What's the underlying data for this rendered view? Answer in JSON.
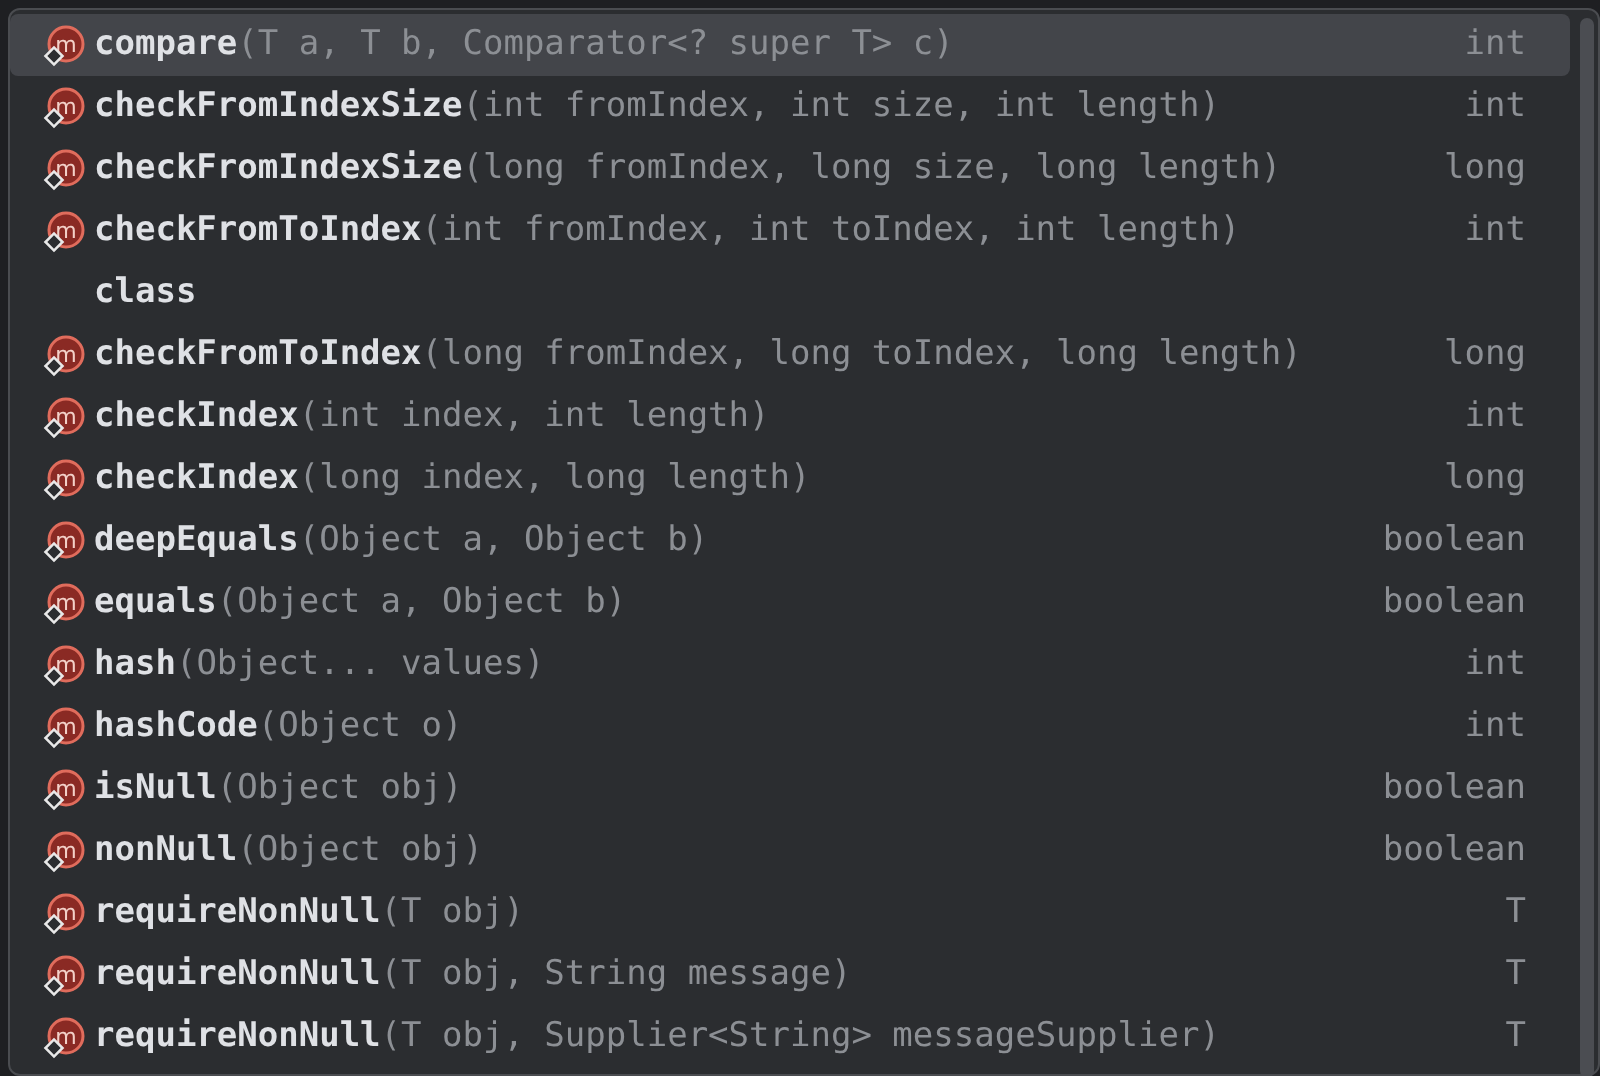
{
  "completions": [
    {
      "kind": "method",
      "icon_letter": "m",
      "name": "compare",
      "params": "(T a, T b, Comparator<? super T> c)",
      "type": "int",
      "selected": true
    },
    {
      "kind": "method",
      "icon_letter": "m",
      "name": "checkFromIndexSize",
      "params": "(int fromIndex, int size, int length)",
      "type": "int",
      "selected": false
    },
    {
      "kind": "method",
      "icon_letter": "m",
      "name": "checkFromIndexSize",
      "params": "(long fromIndex, long size, long length)",
      "type": "long",
      "selected": false
    },
    {
      "kind": "method",
      "icon_letter": "m",
      "name": "checkFromToIndex",
      "params": "(int fromIndex, int toIndex, int length)",
      "type": "int",
      "selected": false
    },
    {
      "kind": "keyword",
      "name": "class",
      "selected": false
    },
    {
      "kind": "method",
      "icon_letter": "m",
      "name": "checkFromToIndex",
      "params": "(long fromIndex, long toIndex, long length)",
      "type": "long",
      "selected": false
    },
    {
      "kind": "method",
      "icon_letter": "m",
      "name": "checkIndex",
      "params": "(int index, int length)",
      "type": "int",
      "selected": false
    },
    {
      "kind": "method",
      "icon_letter": "m",
      "name": "checkIndex",
      "params": "(long index, long length)",
      "type": "long",
      "selected": false
    },
    {
      "kind": "method",
      "icon_letter": "m",
      "name": "deepEquals",
      "params": "(Object a, Object b)",
      "type": "boolean",
      "selected": false
    },
    {
      "kind": "method",
      "icon_letter": "m",
      "name": "equals",
      "params": "(Object a, Object b)",
      "type": "boolean",
      "selected": false
    },
    {
      "kind": "method",
      "icon_letter": "m",
      "name": "hash",
      "params": "(Object... values)",
      "type": "int",
      "selected": false
    },
    {
      "kind": "method",
      "icon_letter": "m",
      "name": "hashCode",
      "params": "(Object o)",
      "type": "int",
      "selected": false
    },
    {
      "kind": "method",
      "icon_letter": "m",
      "name": "isNull",
      "params": "(Object obj)",
      "type": "boolean",
      "selected": false
    },
    {
      "kind": "method",
      "icon_letter": "m",
      "name": "nonNull",
      "params": "(Object obj)",
      "type": "boolean",
      "selected": false
    },
    {
      "kind": "method",
      "icon_letter": "m",
      "name": "requireNonNull",
      "params": "(T obj)",
      "type": "T",
      "selected": false
    },
    {
      "kind": "method",
      "icon_letter": "m",
      "name": "requireNonNull",
      "params": "(T obj, String message)",
      "type": "T",
      "selected": false
    },
    {
      "kind": "method",
      "icon_letter": "m",
      "name": "requireNonNull",
      "params": "(T obj, Supplier<String> messageSupplier)",
      "type": "T",
      "selected": false
    }
  ]
}
